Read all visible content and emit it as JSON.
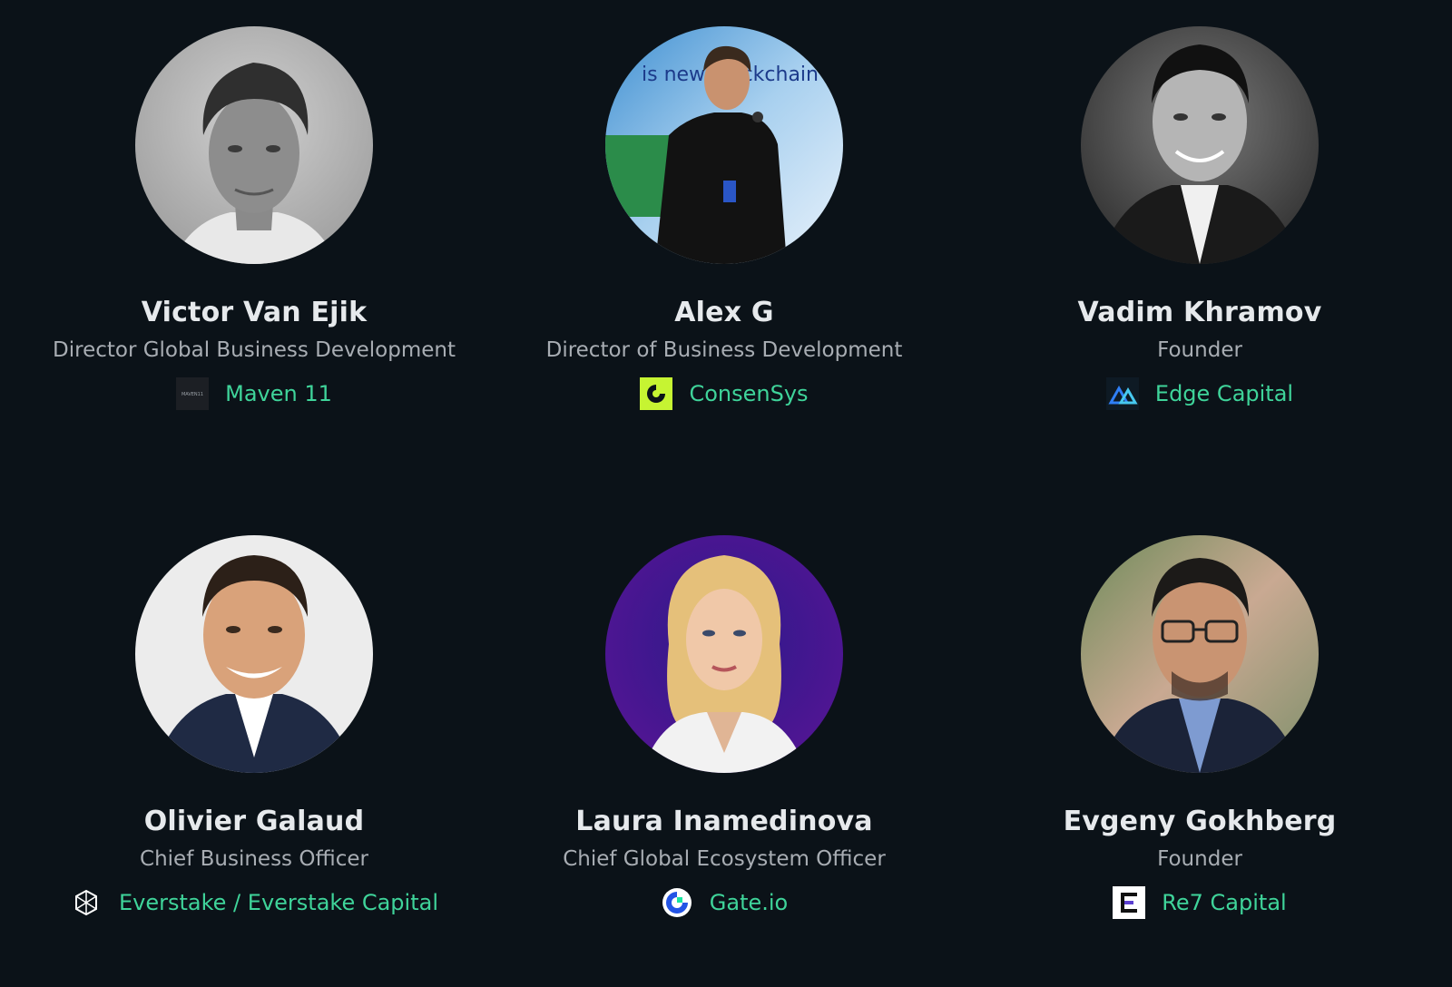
{
  "speakers": [
    {
      "name": "Victor Van Ejik",
      "role": "Director Global Business Development",
      "company": "Maven 11",
      "logo_icon": "maven11-logo-icon",
      "logo_text": "MAVEN11",
      "photo_icon": "portrait-bw-man-icon"
    },
    {
      "name": "Alex G",
      "role": "Director of Business Development",
      "company": "ConsenSys",
      "logo_icon": "consensys-logo-icon",
      "photo_icon": "portrait-speaker-stage-icon",
      "photo_text": "is new blockchain"
    },
    {
      "name": "Vadim Khramov",
      "role": "Founder",
      "company": "Edge Capital",
      "logo_icon": "edge-capital-logo-icon",
      "photo_icon": "portrait-bw-man-suit-icon"
    },
    {
      "name": "Olivier Galaud",
      "role": "Chief Business Officer",
      "company": "Everstake / Everstake Capital",
      "logo_icon": "everstake-logo-icon",
      "photo_icon": "portrait-man-smiling-icon"
    },
    {
      "name": "Laura Inamedinova",
      "role": "Chief Global Ecosystem Officer",
      "company": "Gate.io",
      "logo_icon": "gateio-logo-icon",
      "photo_icon": "portrait-woman-blonde-icon"
    },
    {
      "name": "Evgeny Gokhberg",
      "role": "Founder",
      "company": "Re7 Capital",
      "logo_icon": "re7-capital-logo-icon",
      "photo_icon": "portrait-man-glasses-icon"
    }
  ],
  "colors": {
    "background": "#0b1218",
    "name": "#e6e9ec",
    "role": "#a8adb3",
    "company": "#3fd49a",
    "consensys_accent": "#c6f432"
  }
}
